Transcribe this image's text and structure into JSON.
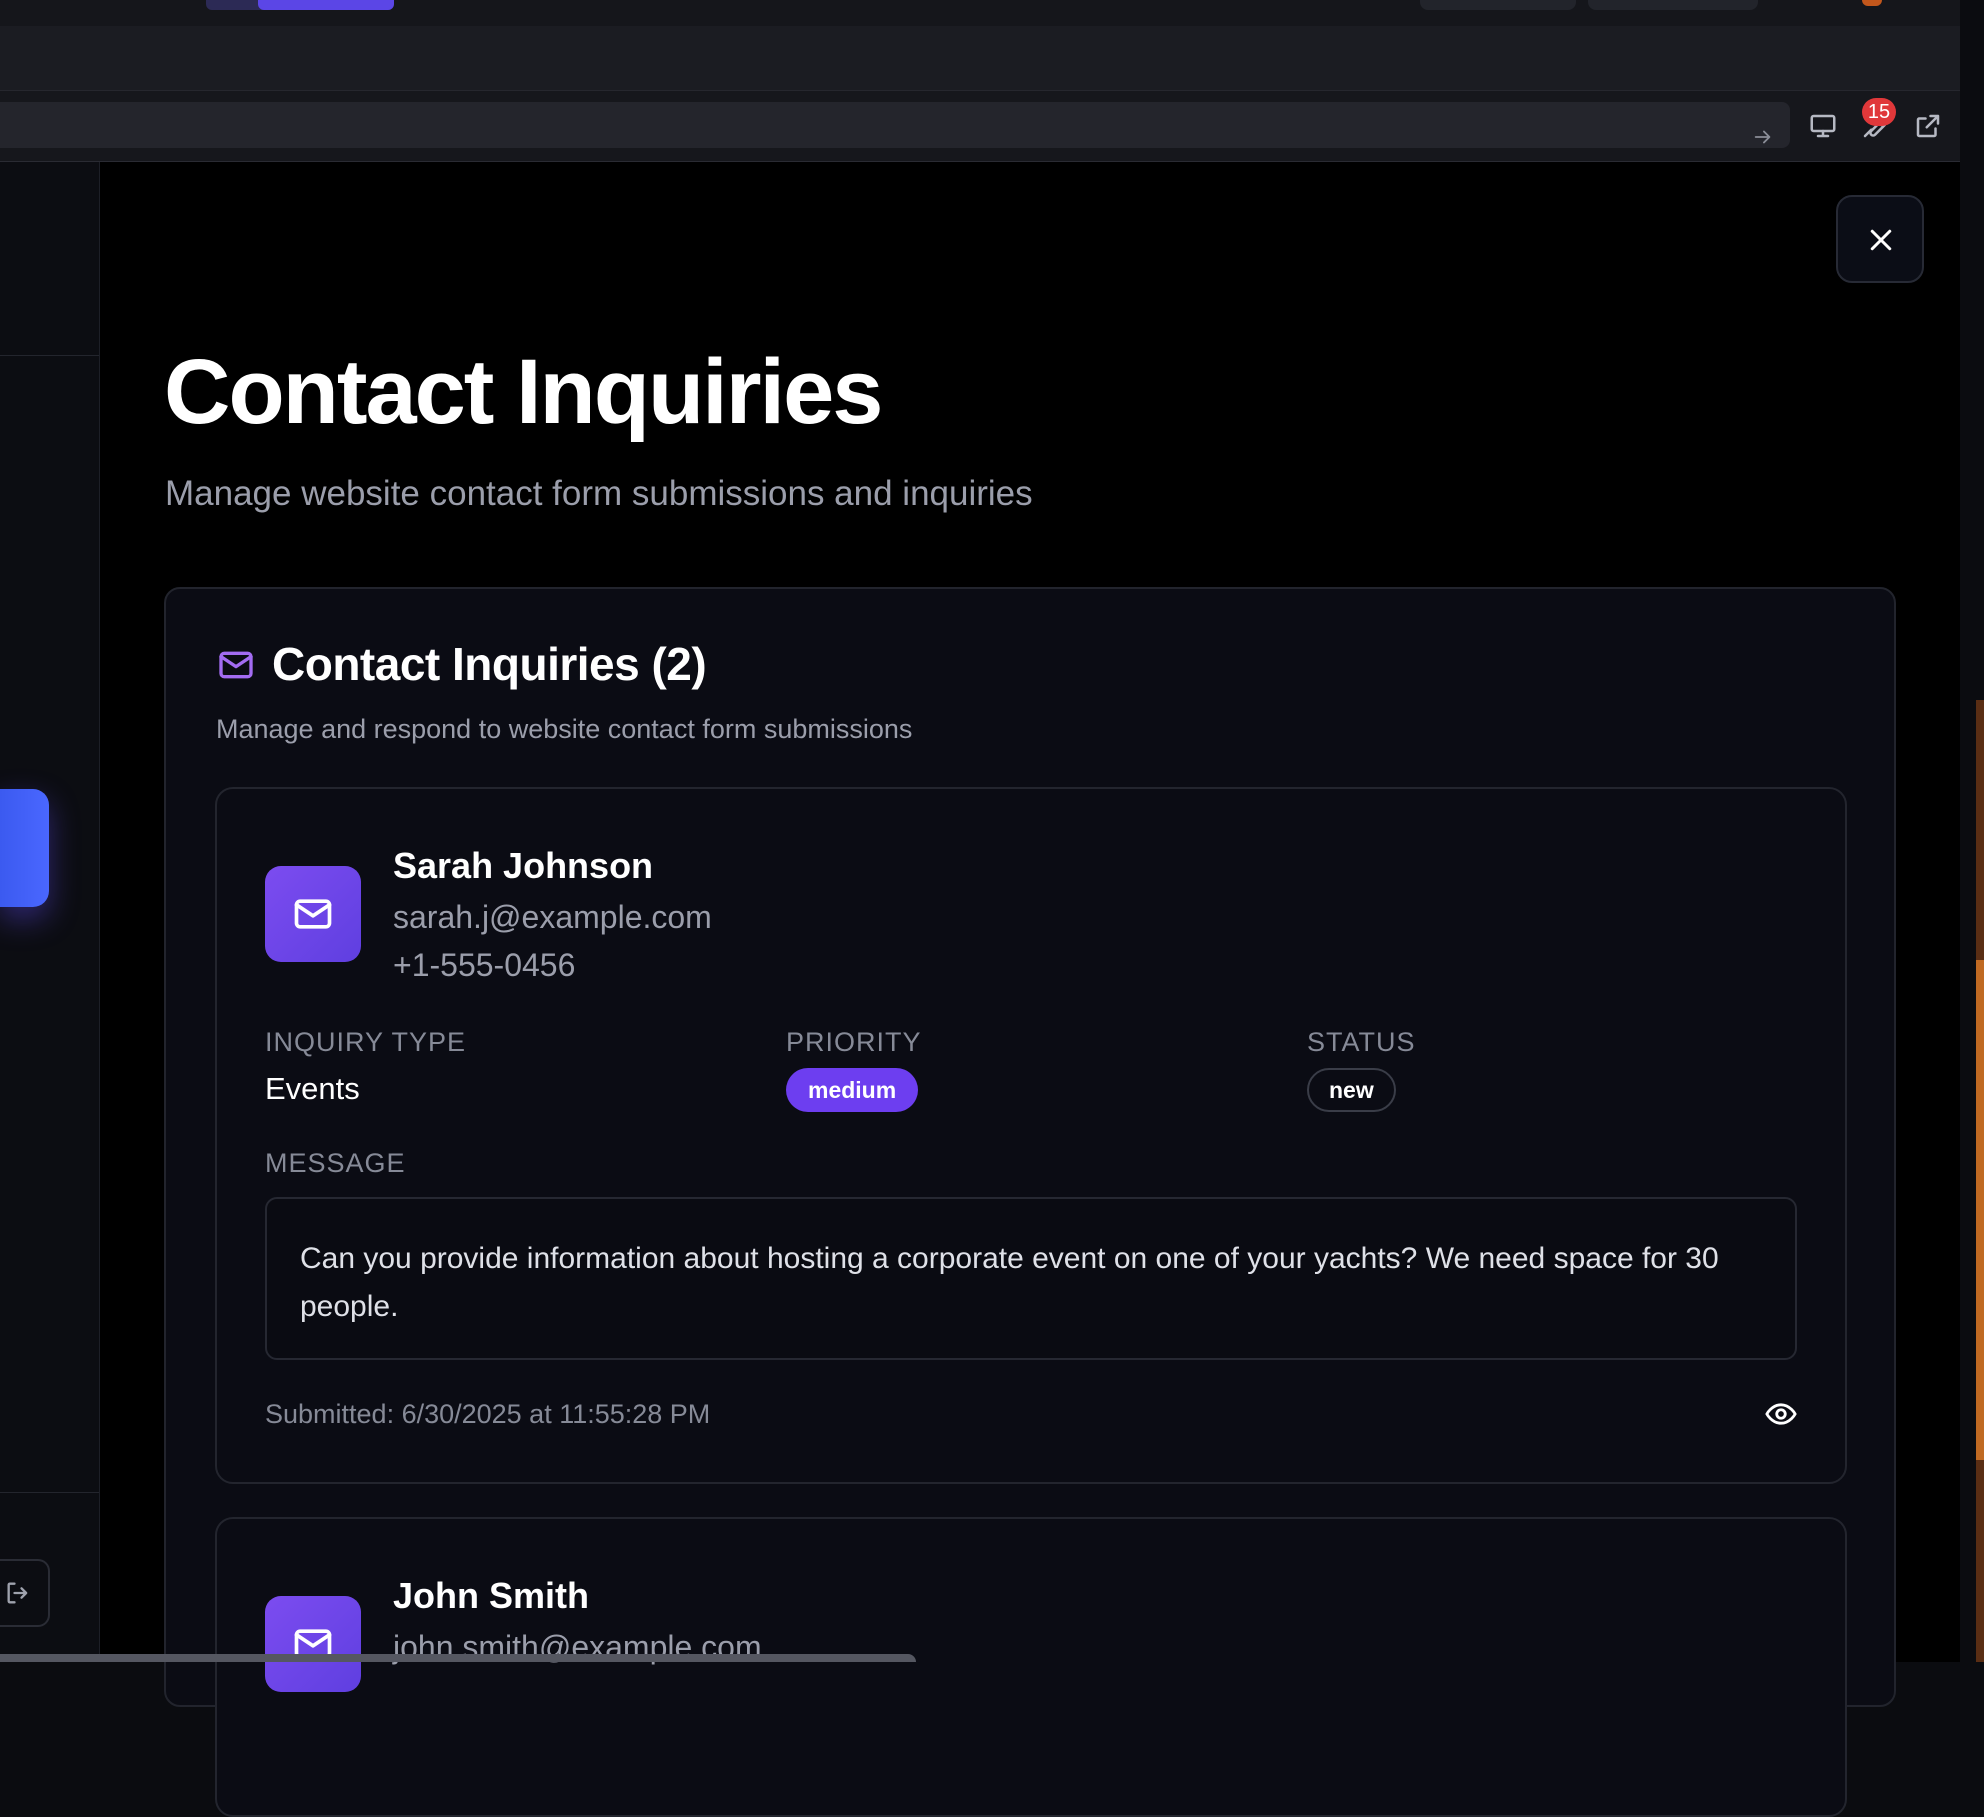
{
  "browser": {
    "notification_count": "15"
  },
  "page": {
    "title": "Contact Inquiries",
    "subtitle": "Manage website contact form submissions and inquiries"
  },
  "card": {
    "title": "Contact Inquiries (2)",
    "subtitle": "Manage and respond to website contact form submissions"
  },
  "labels": {
    "inquiry_type": "INQUIRY TYPE",
    "priority": "PRIORITY",
    "status": "STATUS",
    "message": "MESSAGE"
  },
  "inquiries": [
    {
      "name": "Sarah Johnson",
      "email": "sarah.j@example.com",
      "phone": "+1-555-0456",
      "inquiry_type": "Events",
      "priority": "medium",
      "status": "new",
      "message": "Can you provide information about hosting a corporate event on one of your yachts? We need space for 30 people.",
      "submitted": "Submitted: 6/30/2025 at 11:55:28 PM"
    },
    {
      "name": "John Smith",
      "email": "john.smith@example.com"
    }
  ],
  "colors": {
    "accent": "#6d3ef0",
    "icon_purple": "#a36cf2",
    "badge_red": "#e0383a",
    "sidebar_blue": "#3b5af0"
  }
}
